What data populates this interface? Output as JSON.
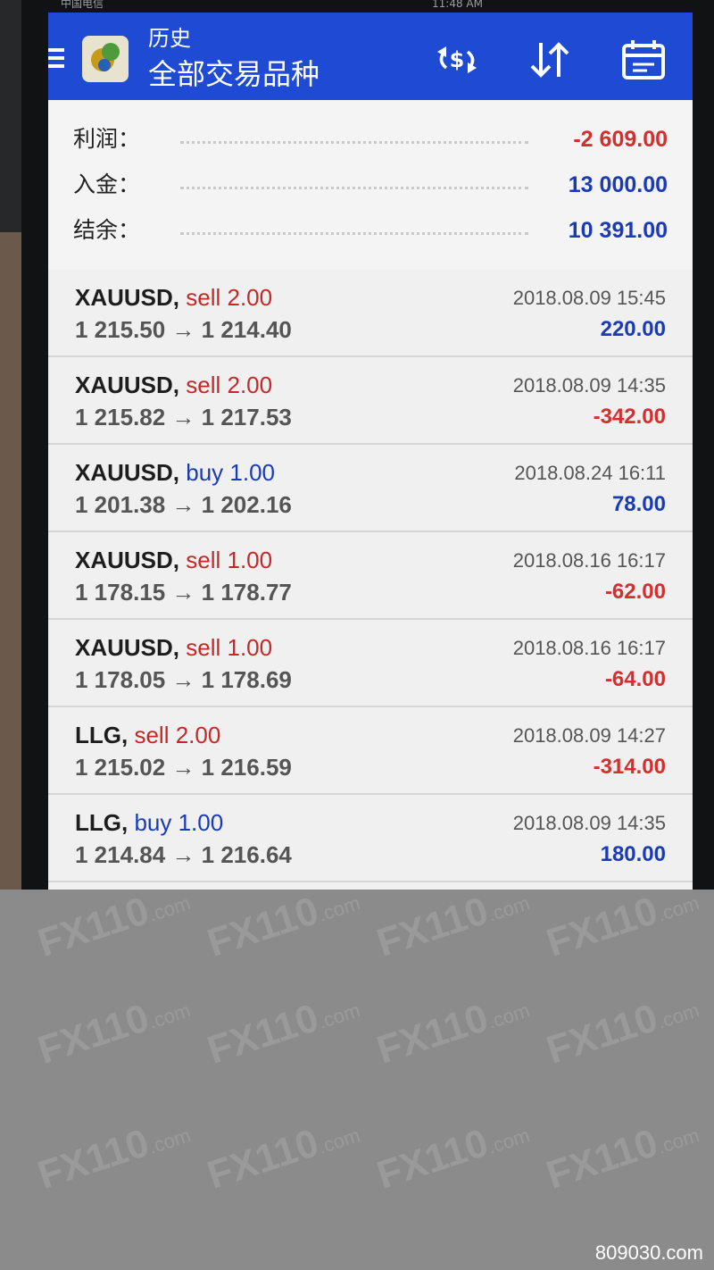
{
  "status_bar": {
    "carrier": "中国电信",
    "time": "11:48 AM"
  },
  "app_bar": {
    "subtitle": "历史",
    "title": "全部交易品种",
    "icons": [
      "menu-icon",
      "app-logo",
      "deposit-withdraw-icon",
      "sort-icon",
      "calendar-icon"
    ]
  },
  "summary": {
    "profit_label": "利润：",
    "profit_value": "-2 609.00",
    "deposit_label": "入金：",
    "deposit_value": "13 000.00",
    "balance_label": "结余：",
    "balance_value": "10 391.00"
  },
  "trades": [
    {
      "symbol": "XAUUSD,",
      "side": "sell 2.00",
      "side_type": "sell",
      "prices": "1 215.50 → 1 214.40",
      "datetime": "2018.08.09 15:45",
      "profit": "220.00",
      "profit_type": "positive"
    },
    {
      "symbol": "XAUUSD,",
      "side": "sell 2.00",
      "side_type": "sell",
      "prices": "1 215.82 → 1 217.53",
      "datetime": "2018.08.09 14:35",
      "profit": "-342.00",
      "profit_type": "negative"
    },
    {
      "symbol": "XAUUSD,",
      "side": "buy 1.00",
      "side_type": "buy",
      "prices": "1 201.38 → 1 202.16",
      "datetime": "2018.08.24 16:11",
      "profit": "78.00",
      "profit_type": "positive"
    },
    {
      "symbol": "XAUUSD,",
      "side": "sell 1.00",
      "side_type": "sell",
      "prices": "1 178.15 → 1 178.77",
      "datetime": "2018.08.16 16:17",
      "profit": "-62.00",
      "profit_type": "negative"
    },
    {
      "symbol": "XAUUSD,",
      "side": "sell 1.00",
      "side_type": "sell",
      "prices": "1 178.05 → 1 178.69",
      "datetime": "2018.08.16 16:17",
      "profit": "-64.00",
      "profit_type": "negative"
    },
    {
      "symbol": "LLG,",
      "side": "sell 2.00",
      "side_type": "sell",
      "prices": "1 215.02 → 1 216.59",
      "datetime": "2018.08.09 14:27",
      "profit": "-314.00",
      "profit_type": "negative"
    },
    {
      "symbol": "LLG,",
      "side": "buy 1.00",
      "side_type": "buy",
      "prices": "1 214.84 → 1 216.64",
      "datetime": "2018.08.09 14:35",
      "profit": "180.00",
      "profit_type": "positive"
    }
  ],
  "watermark": {
    "text": "FX110",
    "suffix": ".com"
  },
  "corner_watermark": "809030.com",
  "colors": {
    "app_bar": "#1f4ad3",
    "sell": "#c62828",
    "buy": "#1a3bb5",
    "positive": "#1a3bb5",
    "negative": "#d32f2f"
  }
}
